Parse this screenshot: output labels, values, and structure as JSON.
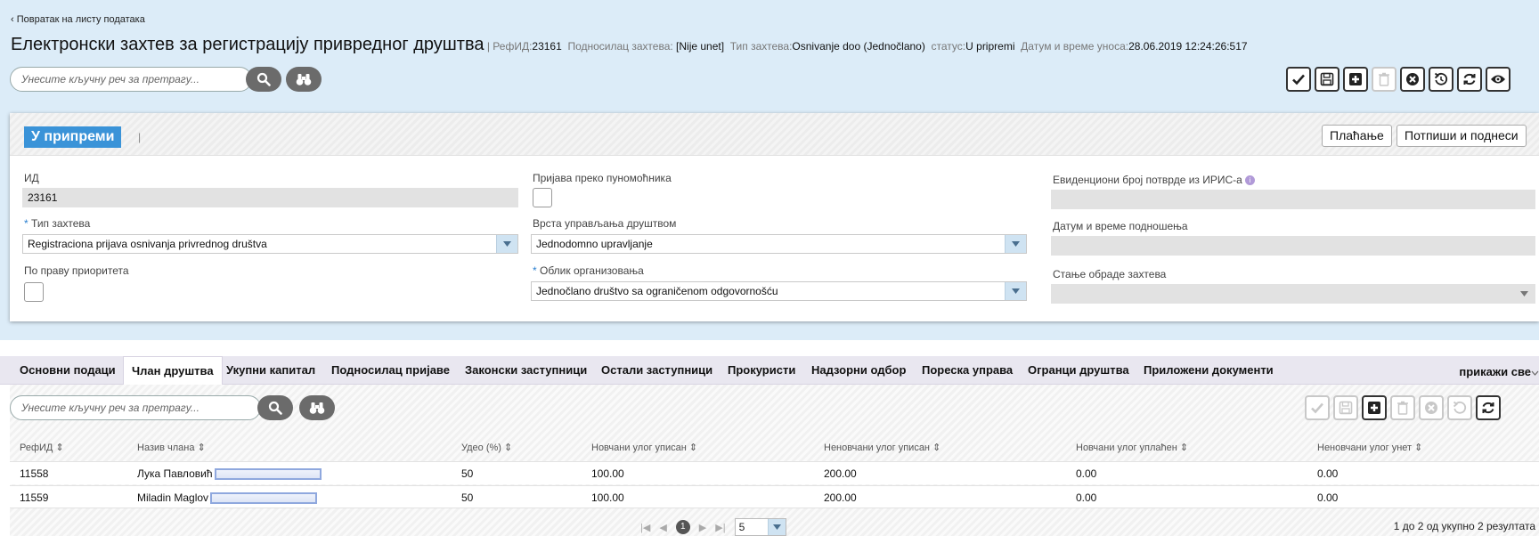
{
  "header": {
    "back_link": "‹ Повратак на листу података",
    "title": "Електронски захтев за регистрацију привредног друштва",
    "sep": "|",
    "refid_label": "РефИД:",
    "refid_value": "23161",
    "applicant_label": "Подносилац захтева:",
    "applicant_value": "[Nije unet]",
    "type_label": "Тип захтева:",
    "type_value": "Osnivanje doo (Jednočlano)",
    "status_label": "статус:",
    "status_value": "U pripremi",
    "date_label": "Датум и време уноса:",
    "date_value": "28.06.2019 12:24:26:517"
  },
  "search": {
    "placeholder": "Унесите кључну реч за претрагу..."
  },
  "toolbar": {
    "buttons": [
      "check-icon",
      "save-icon",
      "add-icon",
      "delete-icon",
      "cancel-icon",
      "undo-icon",
      "refresh-icon",
      "view-icon"
    ]
  },
  "card": {
    "status_badge": "У припреми",
    "separator": "|",
    "pay_button": "Плаћање",
    "sign_button": "Потпиши и поднеси",
    "fields": {
      "id_label": "ИД",
      "id_value": "23161",
      "type_label": "Тип захтева",
      "type_value": "Registraciona prijava osnivanja privrednog društva",
      "priority_label": "По праву приоритета",
      "proxy_label": "Пријава преко пуномоћника",
      "mgmt_label": "Врста управљања друштвом",
      "mgmt_value": "Jednodomno upravljanje",
      "org_label": "Облик организовања",
      "org_value": "Jednočlano društvo sa ograničenom odgovornošću",
      "iris_label": "Евиденциони број потврде из ИРИС-а",
      "submit_date_label": "Датум и време подношења",
      "processing_state_label": "Стање обраде захтева"
    }
  },
  "tabs": {
    "items": [
      "Основни подаци",
      "Члан друштва",
      "Укупни капитал",
      "Подносилац пријаве",
      "Законски заступници",
      "Остали заступници",
      "Прокуристи",
      "Надзорни одбор",
      "Пореска управа",
      "Огранци друштва",
      "Приложени документи"
    ],
    "active": "Члан друштва",
    "show_all": "прикажи све"
  },
  "grid": {
    "search_placeholder": "Унесите кључну реч за претрагу...",
    "columns": [
      "РефИД",
      "Назив члана",
      "Удео (%)",
      "Новчани улог уписан",
      "Неновчани улог уписан",
      "Новчани улог уплаћен",
      "Неновчани улог унет"
    ],
    "rows": [
      [
        "11558",
        "Лука Павловић",
        "50",
        "100.00",
        "200.00",
        "0.00",
        "0.00"
      ],
      [
        "11559",
        "Miladin Maglov",
        "50",
        "100.00",
        "200.00",
        "0.00",
        "0.00"
      ]
    ],
    "pager": {
      "current_page": "1",
      "page_size": "5"
    },
    "results_text": "1 до 2 од укупно 2 резултата"
  },
  "colors": {
    "top_background": "#dcecf8",
    "badge": "#3a93d8",
    "tabs_background": "#e9e7f0",
    "dropdown_arrow": "#cfe3f2"
  }
}
